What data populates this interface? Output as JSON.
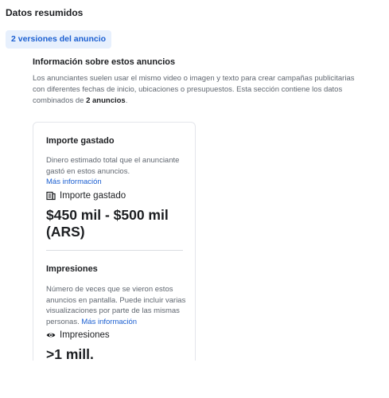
{
  "section": {
    "title": "Datos resumidos"
  },
  "versions": {
    "label": "2 versiones del anuncio"
  },
  "info": {
    "heading": "Información sobre estos anuncios",
    "text_before": "Los anunciantes suelen usar el mismo video o imagen y texto para crear campañas publicitarias con diferentes fechas de inicio, ubicaciones o presupuestos. Esta sección contiene los datos combinados de ",
    "text_bold": "2 anuncios",
    "text_after": "."
  },
  "spend": {
    "title": "Importe gastado",
    "description": "Dinero estimado total que el anunciante gastó en estos anuncios.",
    "more_link": "Más información",
    "label": "Importe gastado",
    "icon": "receipt-icon",
    "value": "$450 mil - $500 mil (ARS)"
  },
  "impressions": {
    "title": "Impresiones",
    "description": "Número de veces que se vieron estos anuncios en pantalla. Puede incluir varias visualizaciones por parte de las mismas personas. ",
    "more_link": "Más información",
    "label": "Impresiones",
    "icon": "eye-icon",
    "value": ">1 mill."
  }
}
